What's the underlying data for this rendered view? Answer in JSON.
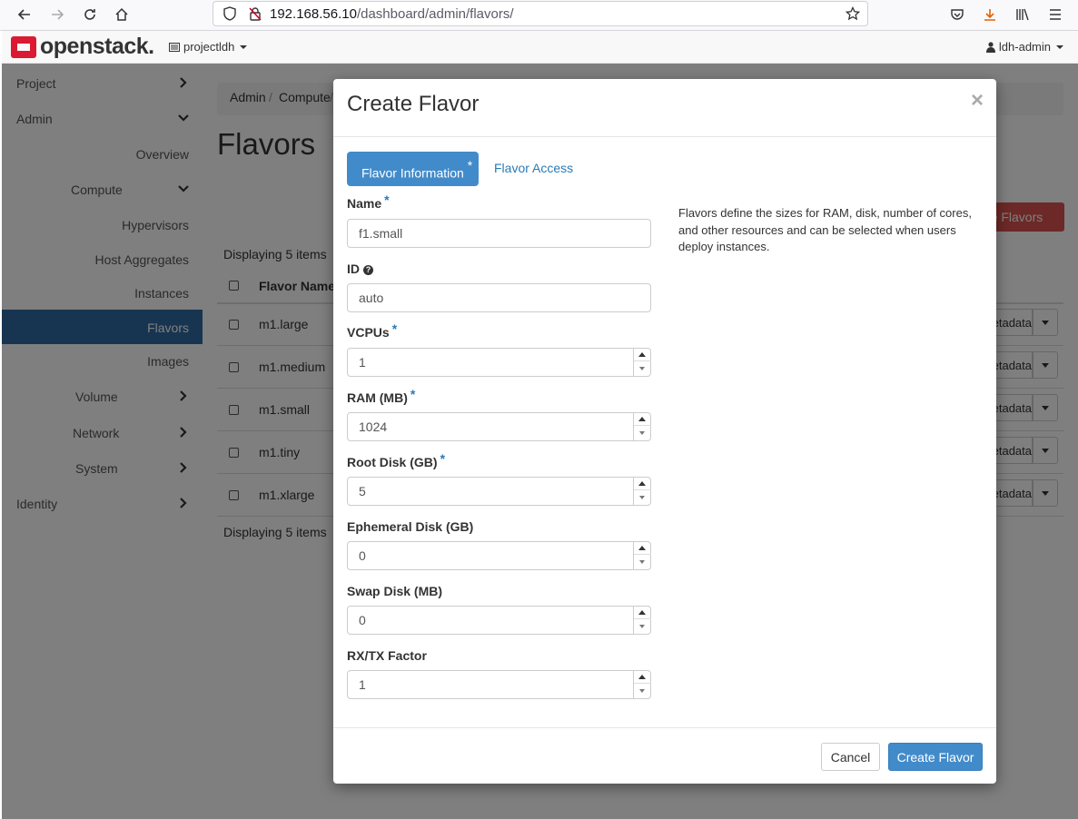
{
  "browser": {
    "url_host": "192.168.56.10",
    "url_path": "/dashboard/admin/flavors/"
  },
  "header": {
    "logo": "openstack.",
    "project": "projectldh",
    "user": "ldh-admin"
  },
  "sidebar": {
    "items": [
      {
        "label": "Project"
      },
      {
        "label": "Admin"
      },
      {
        "label": "Overview"
      },
      {
        "label": "Compute"
      },
      {
        "label": "Hypervisors"
      },
      {
        "label": "Host Aggregates"
      },
      {
        "label": "Instances"
      },
      {
        "label": "Flavors"
      },
      {
        "label": "Images"
      },
      {
        "label": "Volume"
      },
      {
        "label": "Network"
      },
      {
        "label": "System"
      },
      {
        "label": "Identity"
      }
    ]
  },
  "main": {
    "breadcrumb": [
      "Admin",
      "/",
      "Compute",
      "/"
    ],
    "title": "Flavors",
    "delete_button": "Delete Flavors",
    "display_count": "Displaying 5 items",
    "column_header": "Flavor Name",
    "rows": [
      "m1.large",
      "m1.medium",
      "m1.small",
      "m1.tiny",
      "m1.xlarge"
    ],
    "row_action": "Update Metadata"
  },
  "modal": {
    "title": "Create Flavor",
    "close": "×",
    "tabs": {
      "info": "Flavor Information",
      "access": "Flavor Access"
    },
    "required_mark": "*",
    "help_icon_glyph": "?",
    "fields": {
      "name": {
        "label": "Name",
        "value": "f1.small"
      },
      "id": {
        "label": "ID",
        "value": "auto"
      },
      "vcpus": {
        "label": "VCPUs",
        "value": "1"
      },
      "ram": {
        "label": "RAM (MB)",
        "value": "1024"
      },
      "root_disk": {
        "label": "Root Disk (GB)",
        "value": "5"
      },
      "ephemeral": {
        "label": "Ephemeral Disk (GB)",
        "value": "0"
      },
      "swap": {
        "label": "Swap Disk (MB)",
        "value": "0"
      },
      "rxtx": {
        "label": "RX/TX Factor",
        "value": "1"
      }
    },
    "description": "Flavors define the sizes for RAM, disk, number of cores, and other resources and can be selected when users deploy instances.",
    "cancel": "Cancel",
    "submit": "Create Flavor"
  },
  "colors": {
    "accent": "#428bca",
    "active_nav": "#2f6aa3",
    "danger": "#d9534f",
    "logo_red": "#da1a32"
  }
}
